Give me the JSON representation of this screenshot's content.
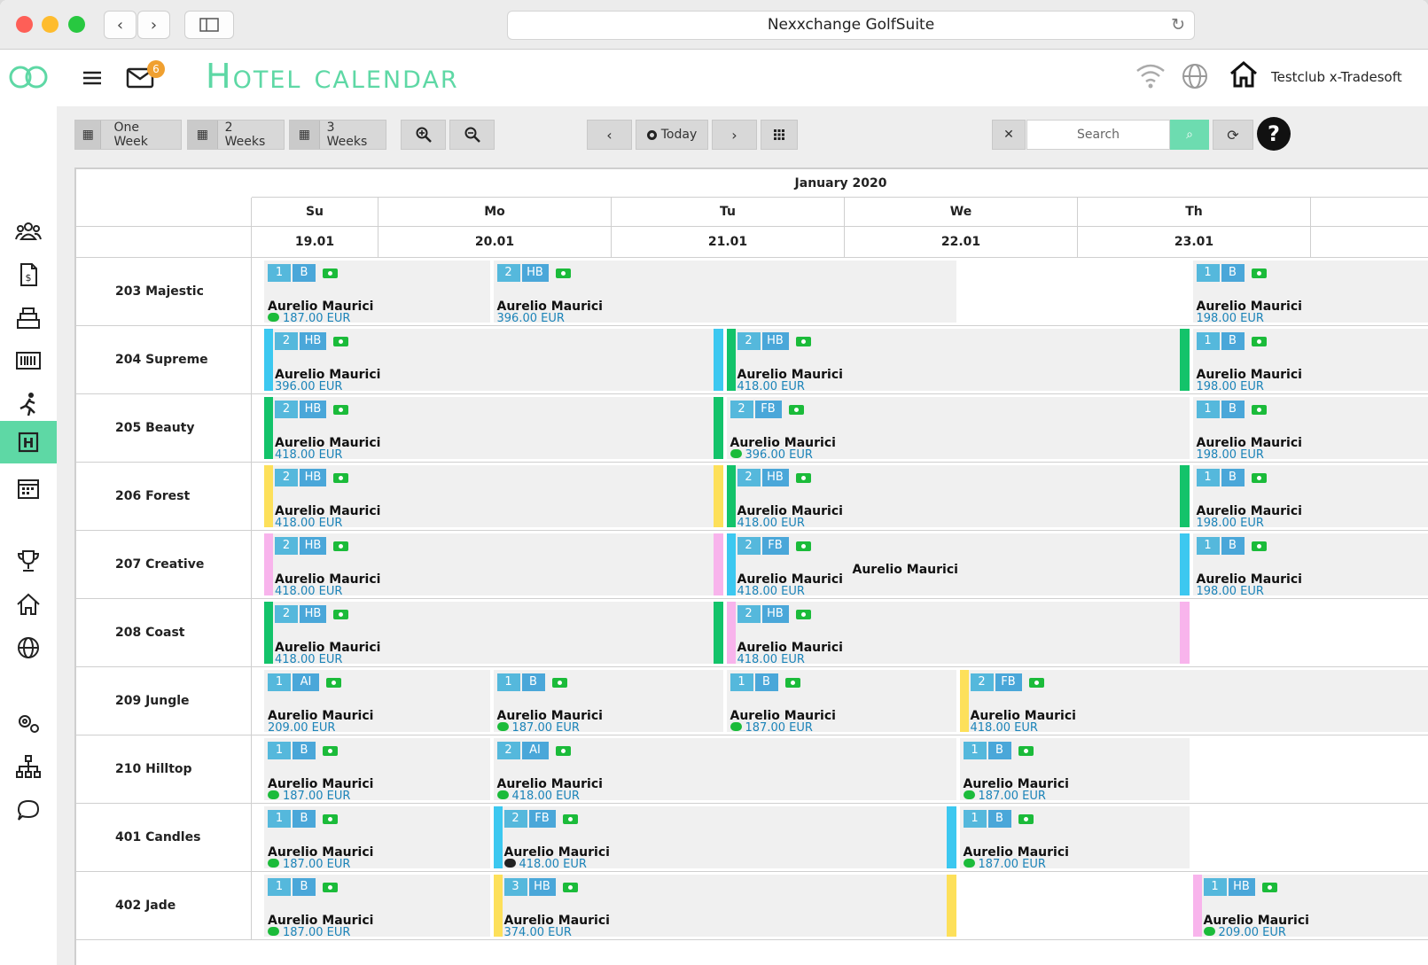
{
  "window": {
    "url_title": "Nexxchange GolfSuite"
  },
  "header": {
    "title": "Hotel calendar",
    "mail_count": "6",
    "club": "Testclub x-Tradesoft"
  },
  "sidebar": {
    "items": [
      "guests-icon",
      "invoice-icon",
      "cash-register-icon",
      "barcode-icon",
      "activity-icon",
      "hotel-icon",
      "calendar-icon",
      "trophy-icon",
      "home-icon",
      "globe-icon",
      "settings-icon",
      "hierarchy-icon",
      "chat-icon"
    ],
    "active": "hotel-icon"
  },
  "toolbar": {
    "one_week": "One Week",
    "two_weeks": "2 Weeks",
    "three_weeks": "3 Weeks",
    "today": "Today",
    "search_placeholder": "Search"
  },
  "calendar": {
    "month": "January 2020",
    "days": [
      {
        "dow": "Su",
        "date": "19.01"
      },
      {
        "dow": "Mo",
        "date": "20.01"
      },
      {
        "dow": "Tu",
        "date": "21.01"
      },
      {
        "dow": "We",
        "date": "22.01"
      },
      {
        "dow": "Th",
        "date": "23.01"
      }
    ],
    "rooms": [
      "203 Majestic",
      "204 Supreme",
      "205 Beauty",
      "206 Forest",
      "207 Creative",
      "208 Coast",
      "209 Jungle",
      "210 Hilltop",
      "401 Candles",
      "402 Jade"
    ],
    "bookings": [
      {
        "room": 0,
        "start": 0,
        "end": 1,
        "persons": "1",
        "board": "B",
        "guest": "Aurelio Maurici",
        "price": "187.00 EUR",
        "icon": "piggy"
      },
      {
        "room": 0,
        "start": 1,
        "end": 3,
        "persons": "2",
        "board": "HB",
        "guest": "Aurelio Maurici",
        "price": "396.00 EUR"
      },
      {
        "room": 0,
        "start": 4,
        "end": 5,
        "persons": "1",
        "board": "B",
        "guest": "Aurelio Maurici",
        "price": "198.00 EUR"
      },
      {
        "room": 1,
        "start": 0,
        "end": 2,
        "persons": "2",
        "board": "HB",
        "guest": "Aurelio Maurici",
        "price": "396.00 EUR",
        "color": "#3cc8f0"
      },
      {
        "room": 1,
        "start": 2,
        "end": 4,
        "persons": "2",
        "board": "HB",
        "guest": "Aurelio Maurici",
        "price": "418.00 EUR",
        "color": "#13c36a"
      },
      {
        "room": 1,
        "start": 4,
        "end": 5,
        "persons": "1",
        "board": "B",
        "guest": "Aurelio Maurici",
        "price": "198.00 EUR"
      },
      {
        "room": 2,
        "start": 0,
        "end": 2,
        "persons": "2",
        "board": "HB",
        "guest": "Aurelio Maurici",
        "price": "418.00 EUR",
        "color": "#13c36a"
      },
      {
        "room": 2,
        "start": 2,
        "end": 4,
        "persons": "2",
        "board": "FB",
        "guest": "Aurelio Maurici",
        "price": "396.00 EUR",
        "icon": "piggy"
      },
      {
        "room": 2,
        "start": 4,
        "end": 5,
        "persons": "1",
        "board": "B",
        "guest": "Aurelio Maurici",
        "price": "198.00 EUR"
      },
      {
        "room": 3,
        "start": 0,
        "end": 2,
        "persons": "2",
        "board": "HB",
        "guest": "Aurelio Maurici",
        "price": "418.00 EUR",
        "color": "#fde05a"
      },
      {
        "room": 3,
        "start": 2,
        "end": 4,
        "persons": "2",
        "board": "HB",
        "guest": "Aurelio Maurici",
        "price": "418.00 EUR",
        "color": "#13c36a"
      },
      {
        "room": 3,
        "start": 4,
        "end": 5,
        "persons": "1",
        "board": "B",
        "guest": "Aurelio Maurici",
        "price": "198.00 EUR"
      },
      {
        "room": 4,
        "start": 0,
        "end": 2,
        "persons": "2",
        "board": "HB",
        "guest": "Aurelio Maurici",
        "price": "418.00 EUR",
        "color": "#f8b4ec"
      },
      {
        "room": 4,
        "start": 2,
        "end": 4,
        "persons": "2",
        "board": "FB",
        "guest": "Aurelio Maurici",
        "price": "418.00 EUR",
        "color": "#3cc8f0",
        "extra": "Aurelio Maurici"
      },
      {
        "room": 4,
        "start": 4,
        "end": 5,
        "persons": "1",
        "board": "B",
        "guest": "Aurelio Maurici",
        "price": "198.00 EUR"
      },
      {
        "room": 5,
        "start": 0,
        "end": 2,
        "persons": "2",
        "board": "HB",
        "guest": "Aurelio Maurici",
        "price": "418.00 EUR",
        "color": "#13c36a"
      },
      {
        "room": 5,
        "start": 2,
        "end": 4,
        "persons": "2",
        "board": "HB",
        "guest": "Aurelio Maurici",
        "price": "418.00 EUR",
        "color": "#f8b4ec"
      },
      {
        "room": 6,
        "start": 0,
        "end": 1,
        "persons": "1",
        "board": "AI",
        "guest": "Aurelio Maurici",
        "price": "209.00 EUR"
      },
      {
        "room": 6,
        "start": 1,
        "end": 2,
        "persons": "1",
        "board": "B",
        "guest": "Aurelio Maurici",
        "price": "187.00 EUR",
        "icon": "piggy"
      },
      {
        "room": 6,
        "start": 2,
        "end": 3,
        "persons": "1",
        "board": "B",
        "guest": "Aurelio Maurici",
        "price": "187.00 EUR",
        "icon": "piggy"
      },
      {
        "room": 6,
        "start": 3,
        "end": 5,
        "persons": "2",
        "board": "FB",
        "guest": "Aurelio Maurici",
        "price": "418.00 EUR",
        "color": "#fde05a"
      },
      {
        "room": 7,
        "start": 0,
        "end": 1,
        "persons": "1",
        "board": "B",
        "guest": "Aurelio Maurici",
        "price": "187.00 EUR",
        "icon": "piggy"
      },
      {
        "room": 7,
        "start": 1,
        "end": 3,
        "persons": "2",
        "board": "AI",
        "guest": "Aurelio Maurici",
        "price": "418.00 EUR",
        "icon": "piggy"
      },
      {
        "room": 7,
        "start": 3,
        "end": 4,
        "persons": "1",
        "board": "B",
        "guest": "Aurelio Maurici",
        "price": "187.00 EUR",
        "icon": "piggy"
      },
      {
        "room": 8,
        "start": 0,
        "end": 1,
        "persons": "1",
        "board": "B",
        "guest": "Aurelio Maurici",
        "price": "187.00 EUR",
        "icon": "piggy"
      },
      {
        "room": 8,
        "start": 1,
        "end": 3,
        "persons": "2",
        "board": "FB",
        "guest": "Aurelio Maurici",
        "price": "418.00 EUR",
        "color": "#3cc8f0",
        "icon": "piggy-dark"
      },
      {
        "room": 8,
        "start": 3,
        "end": 4,
        "persons": "1",
        "board": "B",
        "guest": "Aurelio Maurici",
        "price": "187.00 EUR",
        "icon": "piggy"
      },
      {
        "room": 9,
        "start": 0,
        "end": 1,
        "persons": "1",
        "board": "B",
        "guest": "Aurelio Maurici",
        "price": "187.00 EUR",
        "icon": "piggy"
      },
      {
        "room": 9,
        "start": 1,
        "end": 3,
        "persons": "3",
        "board": "HB",
        "guest": "Aurelio Maurici",
        "price": "374.00 EUR",
        "color": "#fde05a"
      },
      {
        "room": 9,
        "start": 4,
        "end": 5,
        "persons": "1",
        "board": "HB",
        "guest": "Aurelio Maurici",
        "price": "209.00 EUR",
        "color": "#f8b4ec",
        "icon": "piggy"
      }
    ]
  }
}
